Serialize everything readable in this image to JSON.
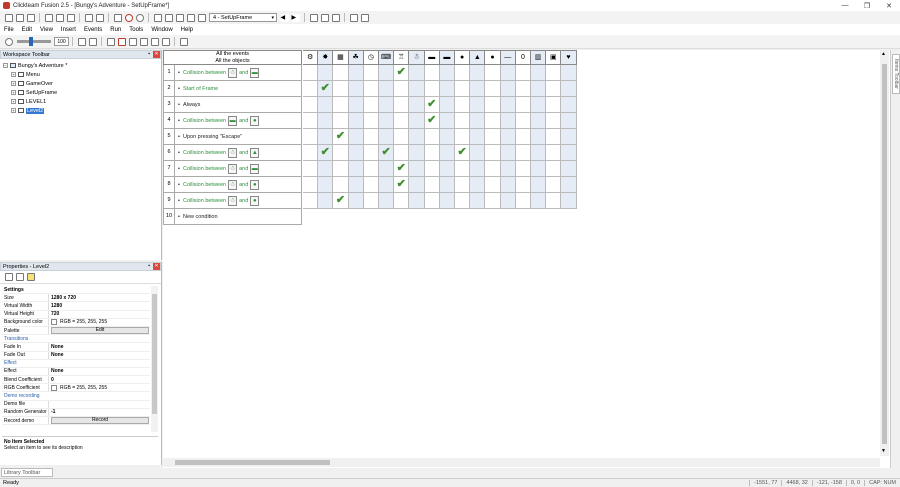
{
  "window": {
    "title": "Clickteam Fusion 2.5 - [Bungy's Adventure - SetUpFrame*]",
    "min": "—",
    "max": "❐",
    "close": "✕"
  },
  "toolbar": {
    "frame_select": "4 - SetUpFrame",
    "zoom": "100"
  },
  "menu": [
    "File",
    "Edit",
    "View",
    "Insert",
    "Events",
    "Run",
    "Tools",
    "Window",
    "Help"
  ],
  "workspace": {
    "title": "Workspace Toolbar",
    "pin": "▪",
    "close": "✕",
    "root": "Bungy's Adventure *",
    "frames": [
      "Menu",
      "GameOver",
      "SetUpFrame",
      "LEVEL1",
      "Level2"
    ]
  },
  "properties": {
    "title": "Properties - Level2",
    "pin": "▪",
    "close": "✕",
    "rows": [
      {
        "type": "header",
        "key": "Settings"
      },
      {
        "type": "row",
        "key": "Size",
        "value": "1280 x 720"
      },
      {
        "type": "row",
        "key": "Virtual Width",
        "value": "1280"
      },
      {
        "type": "row",
        "key": "Virtual Height",
        "value": "720"
      },
      {
        "type": "color",
        "key": "Background color",
        "value": "RGB = 255, 255, 255"
      },
      {
        "type": "button",
        "key": "Palette",
        "value": "Edit"
      },
      {
        "type": "section",
        "key": "Transitions"
      },
      {
        "type": "row",
        "key": "Fade In",
        "value": "None"
      },
      {
        "type": "row",
        "key": "Fade Out",
        "value": "None"
      },
      {
        "type": "section",
        "key": "Effect"
      },
      {
        "type": "row",
        "key": "Effect",
        "value": "None"
      },
      {
        "type": "row",
        "key": "Blend Coefficient",
        "value": "0"
      },
      {
        "type": "color",
        "key": "RGB Coefficient",
        "value": "RGB = 255, 255, 255"
      },
      {
        "type": "section",
        "key": "Demo recording"
      },
      {
        "type": "row",
        "key": "Demo file",
        "value": ""
      },
      {
        "type": "row",
        "key": "Random Generator",
        "value": "-1"
      },
      {
        "type": "button",
        "key": "Record demo",
        "value": "Record"
      }
    ],
    "desc_title": "No Item Selected",
    "desc_text": "Select an item to see its description"
  },
  "library_tab": "Library Toolbar",
  "items_toolbar": "Items Toolbar",
  "editor": {
    "header_line1": "All the events",
    "header_line2": "All the objects",
    "objects": [
      {
        "icon": "system-icon",
        "glyph": "⚙"
      },
      {
        "icon": "gear-icon",
        "glyph": "✸"
      },
      {
        "icon": "checker-icon",
        "glyph": "▦"
      },
      {
        "icon": "mouse-icon",
        "glyph": "☘"
      },
      {
        "icon": "timer-icon",
        "glyph": "◷"
      },
      {
        "icon": "keyboard-icon",
        "glyph": "⌨"
      },
      {
        "icon": "player-icon",
        "glyph": "♖"
      },
      {
        "icon": "bungy-icon",
        "glyph": "☃"
      },
      {
        "icon": "platform-icon",
        "glyph": "▬"
      },
      {
        "icon": "platform2-icon",
        "glyph": "▬"
      },
      {
        "icon": "bomb-icon",
        "glyph": "●"
      },
      {
        "icon": "enemy-icon",
        "glyph": "▲"
      },
      {
        "icon": "ball-icon",
        "glyph": "●"
      },
      {
        "icon": "line-icon",
        "glyph": "—"
      },
      {
        "icon": "zero-icon",
        "glyph": "0"
      },
      {
        "icon": "counter-icon",
        "glyph": "▥"
      },
      {
        "icon": "picture-icon",
        "glyph": "▣"
      },
      {
        "icon": "heart-icon",
        "glyph": "♥"
      }
    ],
    "events": [
      {
        "num": "1",
        "prefix": "Collision between",
        "and": "and",
        "a": "☃",
        "b": "▬",
        "color": "green",
        "ticks": [
          6
        ]
      },
      {
        "num": "2",
        "text": "Start of Frame",
        "color": "green",
        "ticks": [
          1
        ]
      },
      {
        "num": "3",
        "text": "Always",
        "color": "black",
        "ticks": [
          8
        ]
      },
      {
        "num": "4",
        "prefix": "Collision between",
        "and": "and",
        "a": "▬",
        "b": "●",
        "color": "green",
        "ticks": [
          8
        ]
      },
      {
        "num": "5",
        "text": "Upon pressing \"Escape\"",
        "color": "black",
        "ticks": [
          2
        ]
      },
      {
        "num": "6",
        "prefix": "Collision between",
        "and": "and",
        "a": "☃",
        "b": "▲",
        "color": "green",
        "ticks": [
          1,
          5,
          10
        ]
      },
      {
        "num": "7",
        "prefix": "Collision between",
        "and": "and",
        "a": "☃",
        "b": "▬",
        "color": "green",
        "ticks": [
          6
        ]
      },
      {
        "num": "8",
        "prefix": "Collision between",
        "and": "and",
        "a": "☃",
        "b": "●",
        "color": "green",
        "ticks": [
          6
        ]
      },
      {
        "num": "9",
        "prefix": "Collision between",
        "and": "and",
        "a": "☃",
        "b": "●",
        "color": "green",
        "ticks": [
          2
        ]
      }
    ],
    "new_condition": {
      "num": "10",
      "text": "New condition"
    },
    "tick_glyph": "✔"
  },
  "status": {
    "text": "Ready",
    "coords1": "-1551, 77",
    "coords2": "4468, 32",
    "coords3": "-121, -158",
    "coords4": "0, 0",
    "caps": "CAP: NUM"
  },
  "colors": {
    "accent": "#3378d1",
    "tick": "#3f8f30",
    "shade": "#e6ecf6",
    "condition_green": "#2f8f3c"
  }
}
